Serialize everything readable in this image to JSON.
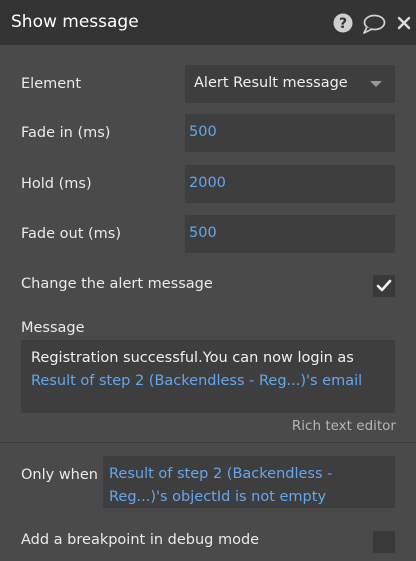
{
  "header": {
    "title": "Show message",
    "icons": [
      "help-icon",
      "comment-icon",
      "close-icon"
    ]
  },
  "fields": {
    "element": {
      "label": "Element",
      "value": "Alert Result message"
    },
    "fade_in": {
      "label": "Fade in (ms)",
      "value": "500"
    },
    "hold": {
      "label": "Hold (ms)",
      "value": "2000"
    },
    "fade_out": {
      "label": "Fade out (ms)",
      "value": "500"
    }
  },
  "change_alert": {
    "label": "Change the alert message",
    "checked": true
  },
  "message": {
    "label": "Message",
    "text": "Registration successful.You can now login as ",
    "dynamic": "Result of step 2 (Backendless - Reg...)'s email",
    "rich_text_link": "Rich text editor"
  },
  "only_when": {
    "label": "Only when",
    "value": "Result of step 2 (Backendless - Reg...)'s objectId is not empty"
  },
  "breakpoint": {
    "label": "Add a breakpoint in debug mode",
    "checked": false
  },
  "colors": {
    "panel_bg": "#4a4a4a",
    "header_bg": "#343434",
    "field_bg": "#3e3e3e",
    "dynamic_text": "#64a7ee"
  }
}
